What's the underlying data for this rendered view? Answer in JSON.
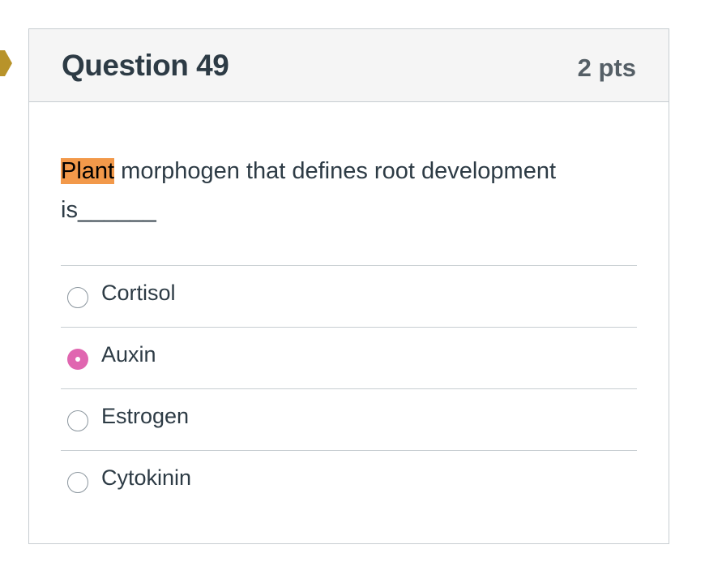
{
  "question": {
    "title": "Question 49",
    "points": "2 pts",
    "text_highlighted": "Plant",
    "text_rest": " morphogen that defines root development is______",
    "highlight_color": "#f2994a"
  },
  "answers": [
    {
      "label": "Cortisol",
      "selected": false
    },
    {
      "label": "Auxin",
      "selected": true
    },
    {
      "label": "Estrogen",
      "selected": false
    },
    {
      "label": "Cytokinin",
      "selected": false
    }
  ],
  "colors": {
    "header_bg": "#f5f5f5",
    "border": "#c7cdd1",
    "radio_selected": "#e066b0",
    "flag_marker": "#b8932a"
  },
  "icons": {
    "flag": "question-flag-icon"
  }
}
